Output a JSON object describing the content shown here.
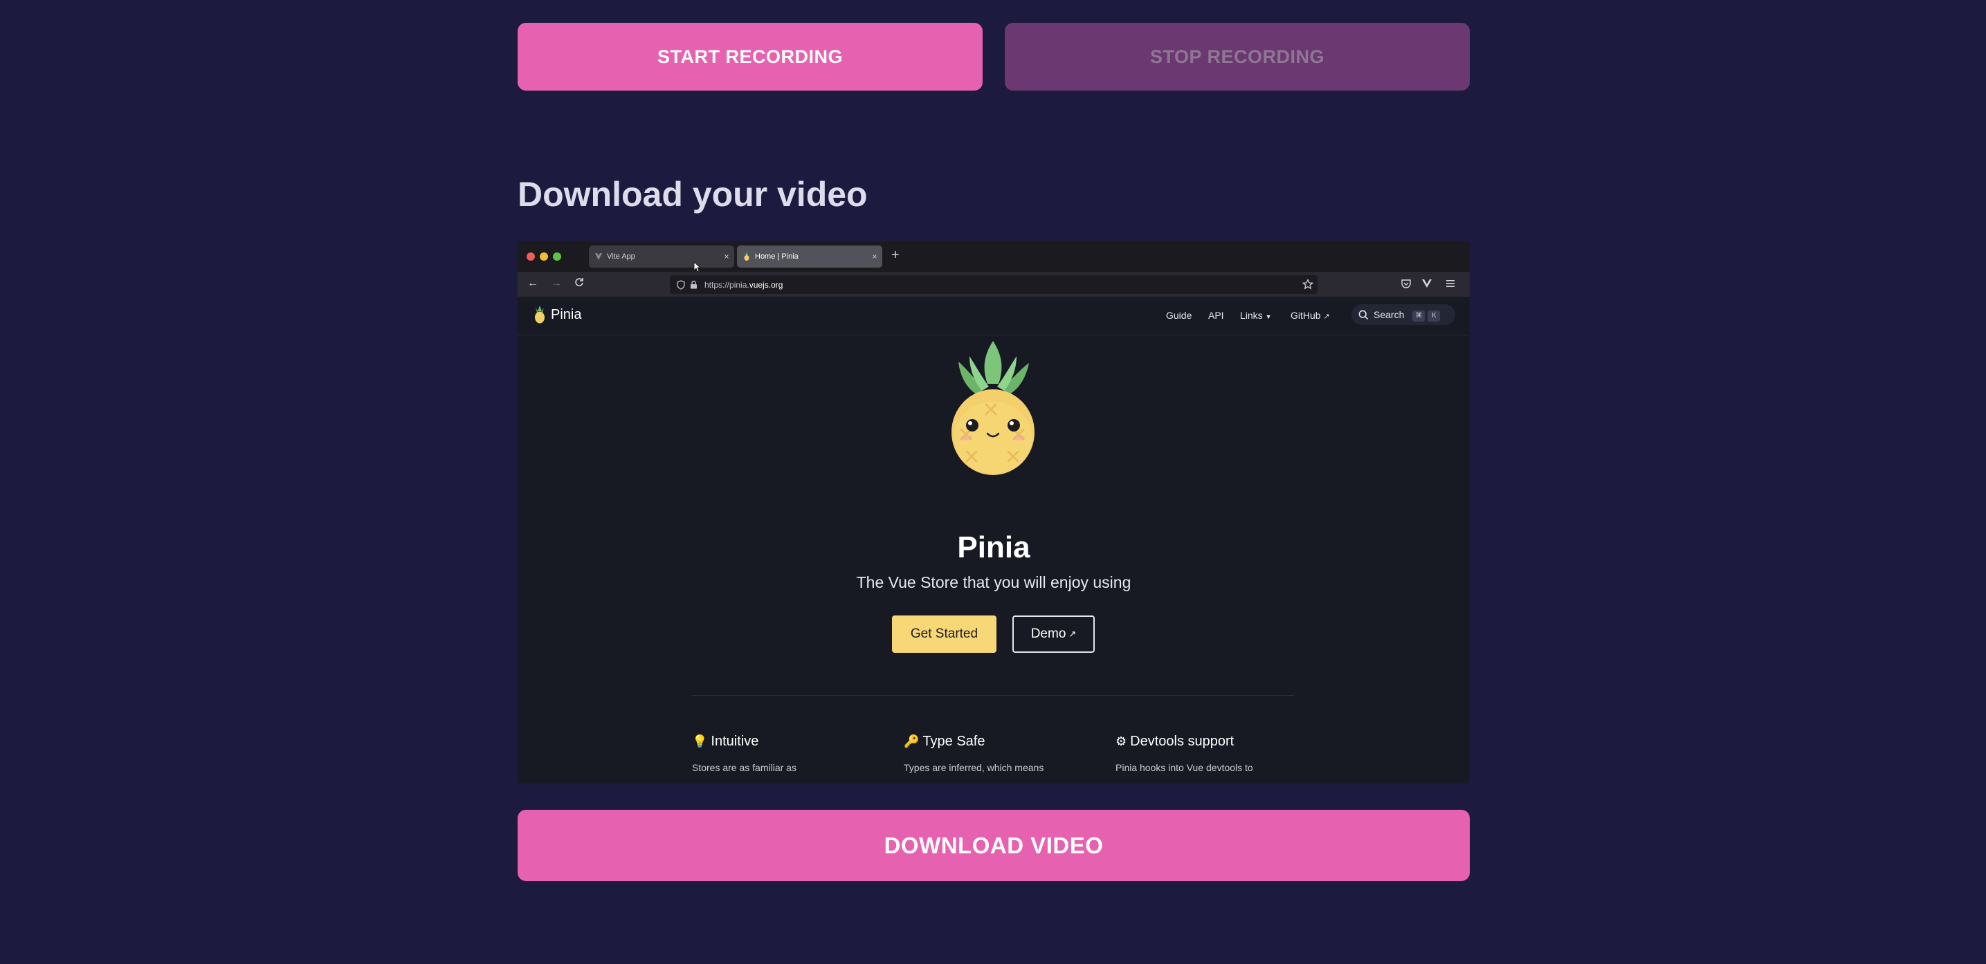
{
  "controls": {
    "start_label": "START RECORDING",
    "stop_label": "STOP RECORDING",
    "download_label": "DOWNLOAD VIDEO"
  },
  "section": {
    "title": "Download your video"
  },
  "video_preview": {
    "browser": {
      "tabs": [
        {
          "label": "Vite App",
          "favicon": "vite-icon",
          "close": "×"
        },
        {
          "label": "Home | Pinia",
          "favicon": "pineapple-icon",
          "close": "×"
        }
      ],
      "new_tab": "+",
      "url_prefix": "https://pinia.",
      "url_domain": "vuejs.org"
    },
    "site": {
      "brand": "Pinia",
      "nav": [
        "Guide",
        "API",
        "Links",
        "GitHub"
      ],
      "search_label": "Search",
      "search_keys": [
        "⌘",
        "K"
      ],
      "hero_title": "Pinia",
      "hero_tagline": "The Vue Store that you will enjoy using",
      "primary_cta": "Get Started",
      "secondary_cta": "Demo",
      "features": [
        {
          "icon": "💡",
          "title": "Intuitive",
          "desc": "Stores are as familiar as"
        },
        {
          "icon": "🔑",
          "title": "Type Safe",
          "desc": "Types are inferred, which means"
        },
        {
          "icon": "⚙",
          "title": "Devtools support",
          "desc": "Pinia hooks into Vue devtools to"
        }
      ]
    }
  },
  "colors": {
    "background": "#1d1a40",
    "accent_pink": "#e662b0",
    "disabled_pink": "#6b3872",
    "pinia_yellow": "#f7d776"
  }
}
